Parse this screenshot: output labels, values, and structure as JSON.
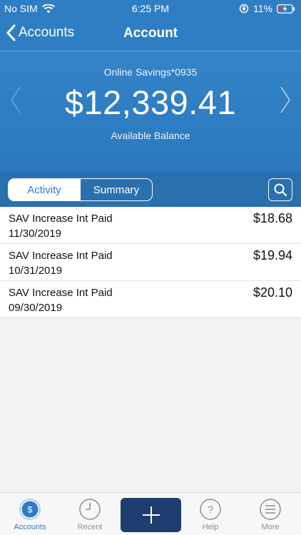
{
  "status_bar": {
    "carrier": "No SIM",
    "time": "6:25 PM",
    "battery": "11%"
  },
  "nav": {
    "back_label": "Accounts",
    "title": "Account"
  },
  "account": {
    "name": "Online Savings*0935",
    "balance": "$12,339.41",
    "balance_label": "Available Balance"
  },
  "segments": {
    "activity": "Activity",
    "summary": "Summary",
    "selected": "Activity"
  },
  "transactions": [
    {
      "description": "SAV Increase Int Paid",
      "date": "11/30/2019",
      "amount": "$18.68"
    },
    {
      "description": "SAV Increase Int Paid",
      "date": "10/31/2019",
      "amount": "$19.94"
    },
    {
      "description": "SAV Increase Int Paid",
      "date": "09/30/2019",
      "amount": "$20.10"
    }
  ],
  "tabs": {
    "accounts": "Accounts",
    "recent": "Recent",
    "help": "Help",
    "more": "More",
    "active": "Accounts"
  },
  "colors": {
    "primary": "#2f7ec3",
    "segment_bar": "#2a6fae",
    "add_button": "#1d3e6e"
  },
  "icons": {
    "status": [
      "wifi-icon",
      "orientation-lock-icon",
      "battery-charging-icon"
    ],
    "nav": [
      "chevron-left-icon"
    ],
    "header": [
      "chevron-left-icon",
      "chevron-right-icon"
    ],
    "segment_bar": [
      "search-icon"
    ],
    "tabs": [
      "dollar-icon",
      "clock-icon",
      "plus-icon",
      "question-icon",
      "menu-icon"
    ]
  }
}
